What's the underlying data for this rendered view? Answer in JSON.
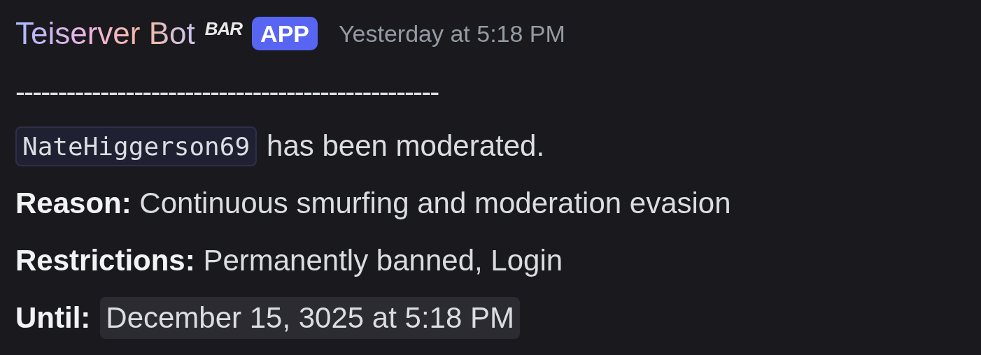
{
  "author": {
    "name": "Teiserver Bot",
    "guild_tag": "BAR",
    "badge": "APP",
    "timestamp": "Yesterday at 5:18 PM"
  },
  "message": {
    "divider": "--------------------------------------------------",
    "lines": [
      {
        "kind": "mention",
        "code": "NateHiggerson69",
        "text": "has been moderated."
      },
      {
        "kind": "text",
        "text": "**Reason:** Continuous smurfing and moderation evasion"
      },
      {
        "kind": "text",
        "text": "**Restrictions:** Permanently banned, Login"
      },
      {
        "kind": "timestamp",
        "label": "Until:",
        "value": "December 15, 3025 at 5:18 PM"
      }
    ]
  }
}
